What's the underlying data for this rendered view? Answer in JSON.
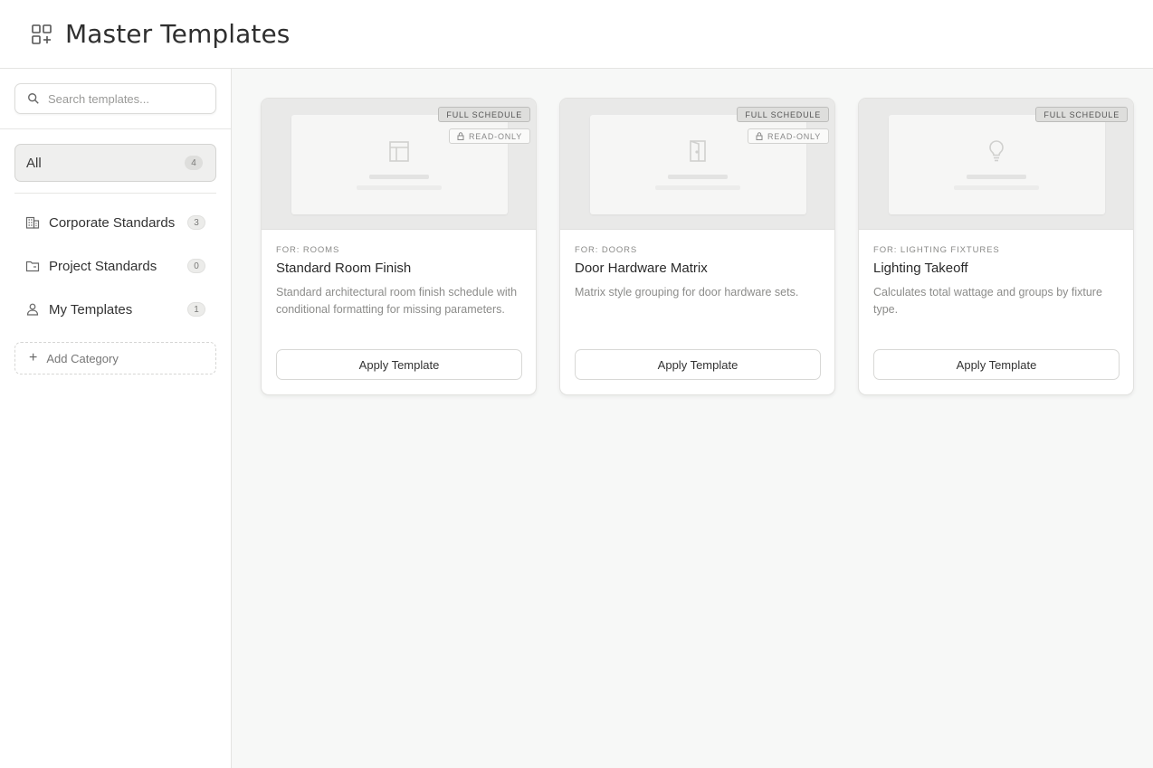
{
  "header": {
    "title": "Master Templates",
    "icon": "grid-plus-icon"
  },
  "sidebar": {
    "search": {
      "placeholder": "Search templates...",
      "value": ""
    },
    "all": {
      "label": "All",
      "count": "4"
    },
    "categories": [
      {
        "label": "Corporate Standards",
        "count": "3",
        "icon": "building-icon"
      },
      {
        "label": "Project Standards",
        "count": "0",
        "icon": "folder-icon"
      },
      {
        "label": "My Templates",
        "count": "1",
        "icon": "user-icon"
      }
    ],
    "add_category_label": "Add Category"
  },
  "templates": [
    {
      "for": "FOR: ROOMS",
      "title": "Standard Room Finish",
      "description": "Standard architectural room finish schedule with conditional formatting for missing parameters.",
      "badge_full": "FULL SCHEDULE",
      "badge_readonly": "READ-ONLY",
      "button": "Apply Template",
      "icon": "room-icon"
    },
    {
      "for": "FOR: DOORS",
      "title": "Door Hardware Matrix",
      "description": "Matrix style grouping for door hardware sets.",
      "badge_full": "FULL SCHEDULE",
      "badge_readonly": "READ-ONLY",
      "button": "Apply Template",
      "icon": "door-icon"
    },
    {
      "for": "FOR: LIGHTING FIXTURES",
      "title": "Lighting Takeoff",
      "description": "Calculates total wattage and groups by fixture type.",
      "badge_full": "FULL SCHEDULE",
      "button": "Apply Template",
      "icon": "lightbulb-icon"
    }
  ]
}
